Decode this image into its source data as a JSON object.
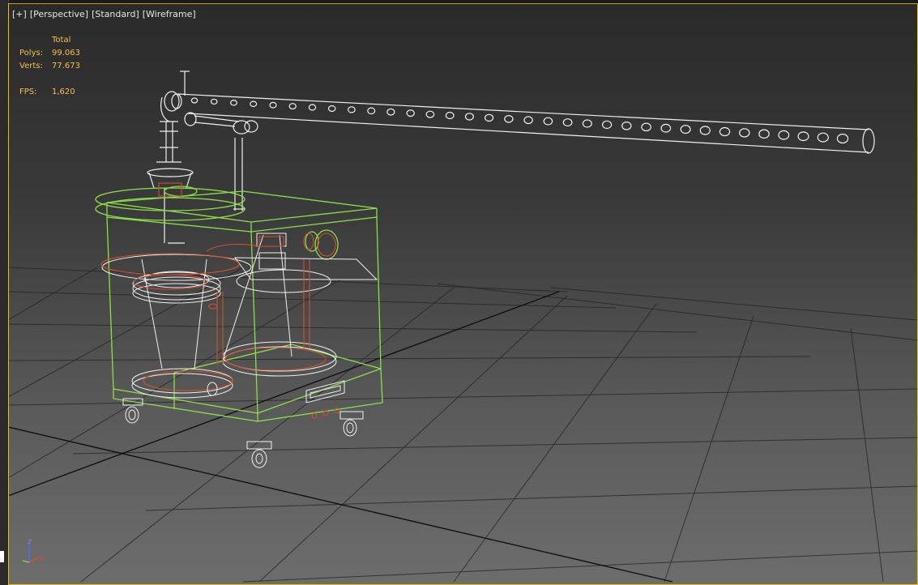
{
  "viewport": {
    "labels": [
      "[+]",
      "[Perspective]",
      "[Standard]",
      "[Wireframe]"
    ]
  },
  "stats": {
    "header": "Total",
    "polys_label": "Polys:",
    "polys_value": "99.063",
    "verts_label": "Verts:",
    "verts_value": "77.673",
    "fps_label": "FPS:",
    "fps_value": "1,620"
  },
  "axis": {
    "z": "z",
    "x": "x"
  },
  "colors": {
    "stats": "#f2c24a",
    "selected_wire": "#8be04a",
    "wire": "#f0f0f0",
    "orange_wire": "#d0502a",
    "grid": "#1e1e1e",
    "frame": "#f0c000"
  }
}
